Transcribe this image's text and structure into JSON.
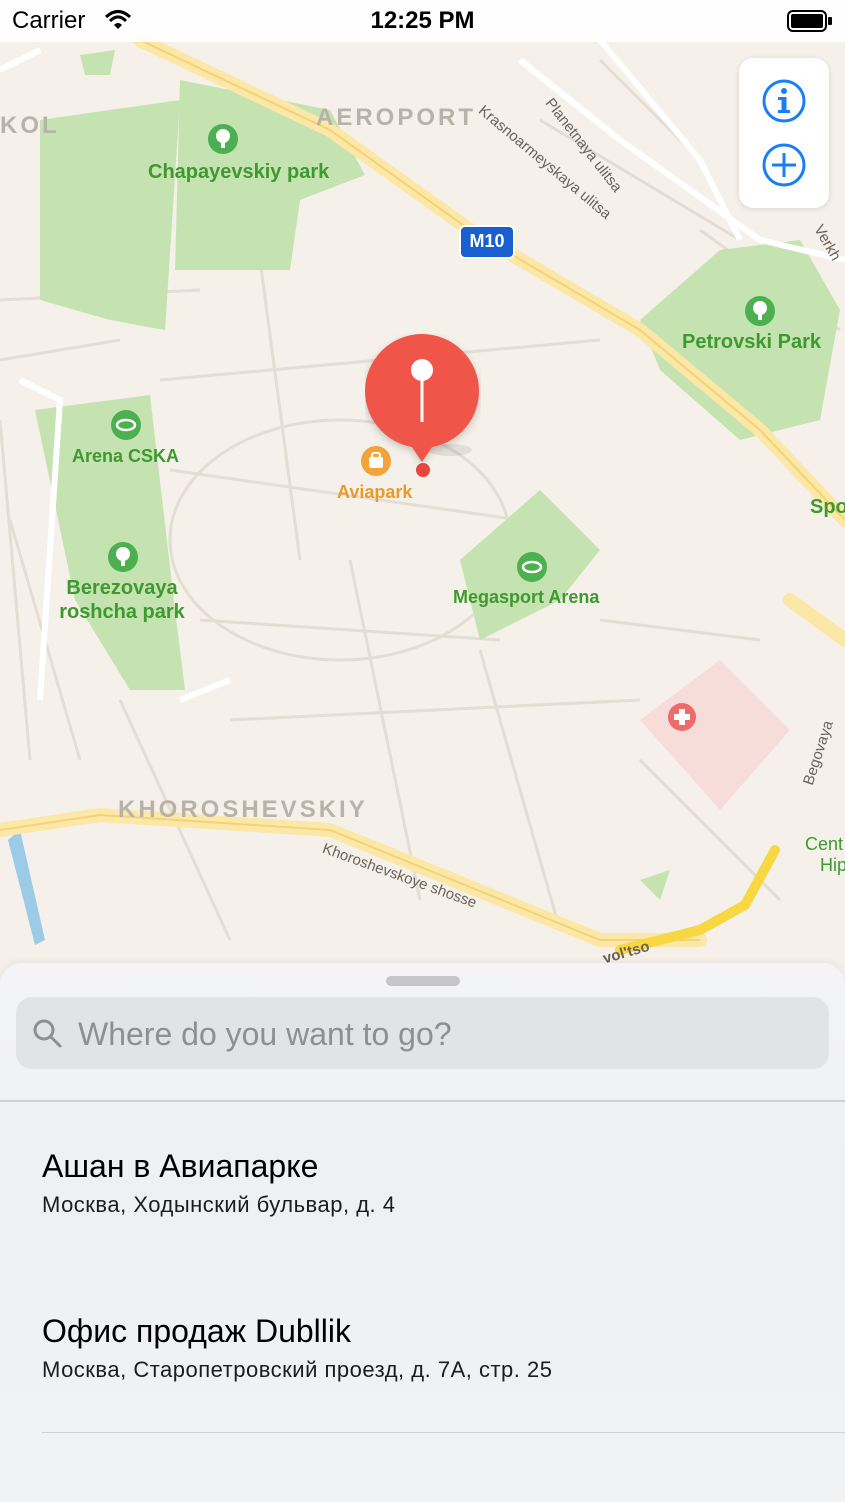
{
  "status_bar": {
    "carrier": "Carrier",
    "time": "12:25 PM"
  },
  "map": {
    "districts": [
      "AEROPORT",
      "KHOROSHEVSKIY",
      "KOL"
    ],
    "parks": [
      "Chapayevskiy park",
      "Petrovski Park",
      "Berezovaya roshcha park"
    ],
    "venues": [
      "Arena CSKA",
      "Megasport Arena"
    ],
    "poi": "Aviapark",
    "streets": [
      "Planetnaya ulitsa",
      "Krasnoarmeyskaya ulitsa",
      "Khoroshevskoye shosse",
      "Begovaya",
      "Verkh",
      "vol'tso"
    ],
    "road_shield": "M10",
    "edge_labels": [
      "Spo",
      "Cent",
      "Hip"
    ]
  },
  "map_controls": {
    "info_icon": "info-icon",
    "zoom_icon": "plus-icon"
  },
  "search": {
    "placeholder": "Where do you want to go?",
    "value": ""
  },
  "results": [
    {
      "title": "Ашан в Авиапарке",
      "subtitle": "Москва, Ходынский бульвар, д. 4"
    },
    {
      "title": "Офис продаж Dubllik",
      "subtitle": "Москва, Старопетровский проезд, д. 7А, стр. 25"
    }
  ],
  "colors": {
    "accent": "#1a7ef5",
    "pin": "#f0544a",
    "park": "#b9e0a5",
    "road_major": "#fde9a0",
    "map_bg": "#f5f1ea"
  }
}
